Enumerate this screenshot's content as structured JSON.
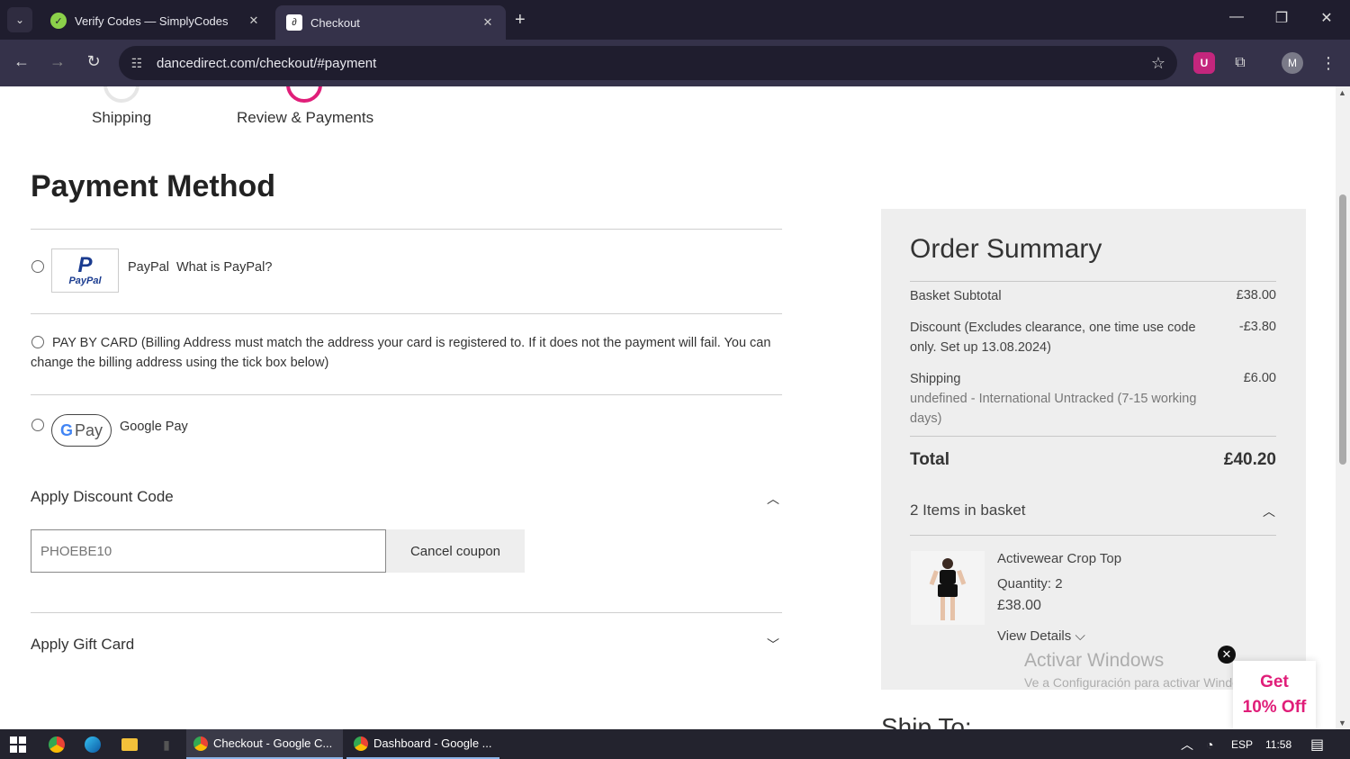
{
  "browser": {
    "tabs": [
      {
        "title": "Verify Codes — SimplyCodes",
        "active": false
      },
      {
        "title": "Checkout",
        "active": true
      }
    ],
    "url": "dancedirect.com/checkout/#payment",
    "profile_initial": "M",
    "ublock_letter": "U"
  },
  "steps": {
    "shipping": "Shipping",
    "review": "Review & Payments"
  },
  "payment": {
    "heading": "Payment Method",
    "paypal_logo_text": "PayPal",
    "paypal_label": "PayPal",
    "paypal_link": "What is PayPal?",
    "card_label": "PAY BY CARD (Billing Address must match the address your card is registered to. If it does not the payment will fail. You can change the billing address using the tick box below)",
    "gpay_logo": "Pay",
    "gpay_g": "G",
    "gpay_label": "Google Pay"
  },
  "discount": {
    "title": "Apply Discount Code",
    "placeholder": "PHOEBE10",
    "cancel_label": "Cancel coupon"
  },
  "gift_card": {
    "title": "Apply Gift Card"
  },
  "summary": {
    "title": "Order Summary",
    "subtotal_label": "Basket Subtotal",
    "subtotal_value": "£38.00",
    "discount_label": "Discount (Excludes clearance, one time use code only. Set up 13.08.2024)",
    "discount_value": "-£3.80",
    "shipping_label": "Shipping",
    "shipping_detail": "undefined - International Untracked (7-15 working days)",
    "shipping_value": "£6.00",
    "total_label": "Total",
    "total_value": "£40.20",
    "items_count_label": "2 Items in basket",
    "item": {
      "name": "Activewear Crop Top",
      "quantity": "Quantity: 2",
      "price": "£38.00",
      "details": "View Details"
    }
  },
  "ship_to": "Ship To:",
  "promo": {
    "line1": "Get",
    "line2": "10% Off"
  },
  "watermark": {
    "line1": "Activar Windows",
    "line2": "Ve a Configuración para activar Windows."
  },
  "taskbar": {
    "apps": [
      "Checkout - Google C...",
      "Dashboard - Google ..."
    ],
    "language": "ESP",
    "time": "11:58"
  }
}
